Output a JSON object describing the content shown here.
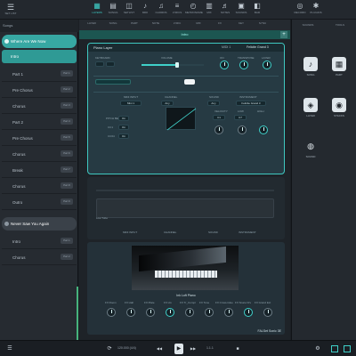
{
  "toolbar": {
    "left_label": "SET LIST",
    "items": [
      {
        "icon": "▦",
        "label": "LAYERS"
      },
      {
        "icon": "▤",
        "label": "SONGS"
      },
      {
        "icon": "◫",
        "label": "SETLIST"
      },
      {
        "icon": "♪",
        "label": "MIDI"
      },
      {
        "icon": "♫",
        "label": "CHORDS"
      },
      {
        "icon": "≡",
        "label": "LYRICS"
      },
      {
        "icon": "◴",
        "label": "METRONOME"
      },
      {
        "icon": "▥",
        "label": "MIX"
      },
      {
        "icon": "♬",
        "label": "NOTES"
      },
      {
        "icon": "▣",
        "label": "SOUNDS"
      },
      {
        "icon": "◧",
        "label": "BAR"
      }
    ],
    "right_items": [
      {
        "icon": "◎",
        "label": "RECORD"
      },
      {
        "icon": "✱",
        "label": "PLUGINS"
      }
    ]
  },
  "sidebar": {
    "header": "Songs",
    "songs": [
      {
        "name": "Where Are We Now",
        "state": "active"
      },
      {
        "name": "Intro",
        "state": "selected"
      }
    ],
    "parts": [
      {
        "name": "Part 1",
        "tag": "Part 1"
      },
      {
        "name": "Pre Chorus",
        "tag": "Part 2"
      },
      {
        "name": "Chorus",
        "tag": "Part 3"
      },
      {
        "name": "Part 2",
        "tag": "Part 4"
      },
      {
        "name": "Pre Chorus",
        "tag": "Part 5"
      },
      {
        "name": "Chorus",
        "tag": "Part 6"
      },
      {
        "name": "Break",
        "tag": "Part 7"
      },
      {
        "name": "Chorus",
        "tag": "Part 8"
      },
      {
        "name": "Outro",
        "tag": "Part 9"
      }
    ],
    "song2": {
      "name": "Never Saw You Again",
      "state": "dark"
    },
    "parts2": [
      {
        "name": "Intro",
        "tag": "Part 1"
      },
      {
        "name": "Chorus",
        "tag": "Part 2"
      }
    ]
  },
  "main": {
    "subtabs": [
      "LAYER",
      "SONG",
      "PART",
      "NOTE",
      "LYRIC",
      "MIX",
      "FX",
      "KEY",
      "SYNC"
    ],
    "track_title": "Intro",
    "plus": "+",
    "instrument": {
      "name": "Piano Layer",
      "mid": "MIDI 1",
      "right": "Felicite Grand 3",
      "labels": {
        "keyboard": "KEYBOARD",
        "volume": "VOLUME",
        "on": "ON",
        "transpose": "TRANSPOSE",
        "layer": "LAYER",
        "midi_input": "MIDI INPUT",
        "channel": "CHANNEL",
        "sound": "SOUND",
        "instrument": "INSTRUMENT",
        "velocity_curve": "VELOCITY CURVE",
        "velocity": "VELOCITY",
        "low": "LOW",
        "high": "HIGH",
        "pitch_bend": "PITCH BEND",
        "cc1": "CC1",
        "cc64": "CC64"
      },
      "values": {
        "midi_input": "Mini 1",
        "channel": "Any",
        "sound": "Any",
        "instrument": "Felicite Grand 3",
        "velocity_min": "C1",
        "velocity_max": "C7",
        "pitch_bend_val": "On",
        "cc1_val": "On",
        "cc64_val": "On"
      }
    },
    "second_labels": [
      "MIDI INPUT",
      "CHANNEL",
      "SOUND",
      "INSTRUMENT"
    ],
    "second_row": "Low Tube",
    "piano": {
      "name": "Ink Loft Piano",
      "footer": "FALSet Sonic 3E",
      "controls": [
        "FX Room",
        "FX Hall",
        "FX Plate",
        "FX Lfo",
        "FX Tr_Compr",
        "FX Tone",
        "FX Cross-Glue",
        "FX Snare Drv",
        "FX Grand Ext"
      ]
    }
  },
  "right_panel": {
    "tabs": [
      "SOUNDS",
      "TOOLS"
    ],
    "items": [
      {
        "icon": "♪",
        "label": "SONG"
      },
      {
        "icon": "▦",
        "label": "PART"
      },
      {
        "icon": "◈",
        "label": "LAYER"
      },
      {
        "icon": "◉",
        "label": "STACKS"
      },
      {
        "icon": "◍",
        "label": "SOUND"
      }
    ]
  },
  "transport": {
    "tempo": "120.000 (4/4)",
    "bars": "1.1.1",
    "play": "▶",
    "stop": "■",
    "prev": "◀◀",
    "next": "▶▶",
    "loop": "⟳"
  },
  "colors": {
    "accent": "#3fd0c9",
    "active_song": "#37a8a3",
    "track_bar": "#1c5651",
    "panel": "#263a43"
  }
}
